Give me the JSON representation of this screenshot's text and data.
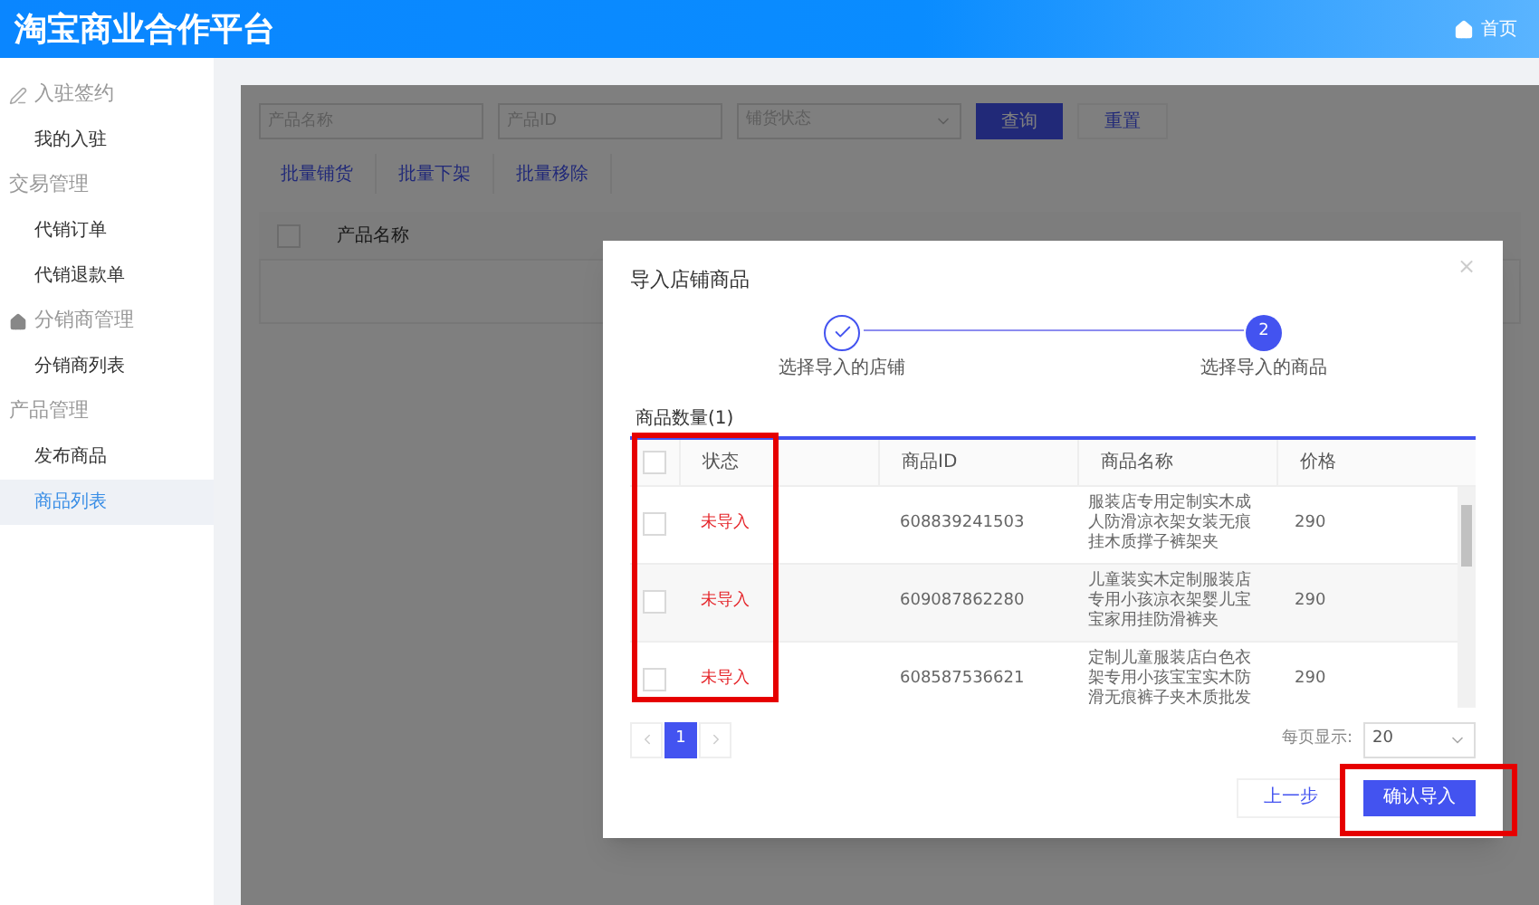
{
  "header": {
    "title": "淘宝商业合作平台",
    "home_link": "首页"
  },
  "sidebar": {
    "groups": [
      {
        "label": "入驻签约",
        "items": [
          {
            "label": "我的入驻",
            "selected": false
          }
        ]
      },
      {
        "label": "交易管理",
        "items": [
          {
            "label": "代销订单",
            "selected": false
          },
          {
            "label": "代销退款单",
            "selected": false
          }
        ]
      },
      {
        "label": "分销商管理",
        "items": [
          {
            "label": "分销商列表",
            "selected": false
          }
        ]
      },
      {
        "label": "产品管理",
        "items": [
          {
            "label": "发布商品",
            "selected": false
          },
          {
            "label": "商品列表",
            "selected": true
          }
        ]
      }
    ]
  },
  "filters": {
    "inputs": [
      {
        "placeholder": "产品名称"
      },
      {
        "placeholder": "产品ID"
      }
    ],
    "select": {
      "placeholder": "铺货状态"
    },
    "query_button": "查询",
    "reset_button": "重置"
  },
  "batch_actions": [
    "批量铺货",
    "批量下架",
    "批量移除"
  ],
  "background_table": {
    "checked": false,
    "columns": [
      "产品名称"
    ]
  },
  "modal": {
    "title": "导入店铺商品",
    "close": "×",
    "steps": [
      {
        "label": "选择导入的店铺",
        "done": true
      },
      {
        "label": "选择导入的商品",
        "done": false,
        "number": "2"
      }
    ],
    "tab": "商品数量(1)",
    "table": {
      "checked": false,
      "columns": [
        "状态",
        "商品ID",
        "商品名称",
        "价格"
      ],
      "rows": [
        {
          "checked": false,
          "status": "未导入",
          "id": "608839241503",
          "name": "服装店专用定制实木成人防滑凉衣架女装无痕挂木质撑子裤架夹",
          "price": "290"
        },
        {
          "checked": false,
          "status": "未导入",
          "id": "609087862280",
          "name": "儿童装实木定制服装店专用小孩凉衣架婴儿宝宝家用挂防滑裤夹",
          "price": "290"
        },
        {
          "checked": false,
          "status": "未导入",
          "id": "608587536621",
          "name": "定制儿童服装店白色衣架专用小孩宝宝实木防滑无痕裤子夹木质批发",
          "price": "290"
        }
      ]
    },
    "pagination": {
      "pages": [
        {
          "label": "1",
          "selected": true
        }
      ]
    },
    "page_size": {
      "label": "每页显示:",
      "value": "20"
    },
    "prev_button": "上一步",
    "confirm_button": "确认导入"
  }
}
